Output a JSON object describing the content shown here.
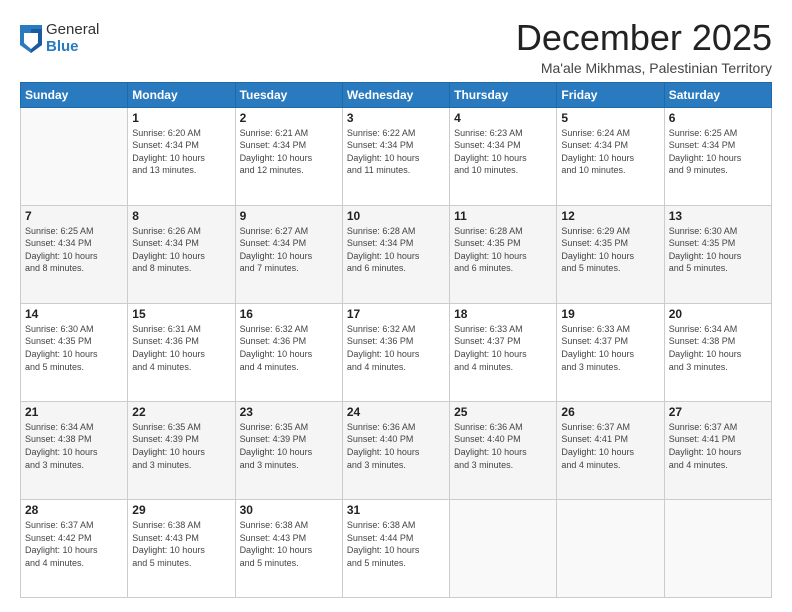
{
  "logo": {
    "general": "General",
    "blue": "Blue"
  },
  "title": "December 2025",
  "subtitle": "Ma'ale Mikhmas, Palestinian Territory",
  "weekdays": [
    "Sunday",
    "Monday",
    "Tuesday",
    "Wednesday",
    "Thursday",
    "Friday",
    "Saturday"
  ],
  "weeks": [
    [
      {
        "day": "",
        "info": ""
      },
      {
        "day": "1",
        "info": "Sunrise: 6:20 AM\nSunset: 4:34 PM\nDaylight: 10 hours\nand 13 minutes."
      },
      {
        "day": "2",
        "info": "Sunrise: 6:21 AM\nSunset: 4:34 PM\nDaylight: 10 hours\nand 12 minutes."
      },
      {
        "day": "3",
        "info": "Sunrise: 6:22 AM\nSunset: 4:34 PM\nDaylight: 10 hours\nand 11 minutes."
      },
      {
        "day": "4",
        "info": "Sunrise: 6:23 AM\nSunset: 4:34 PM\nDaylight: 10 hours\nand 10 minutes."
      },
      {
        "day": "5",
        "info": "Sunrise: 6:24 AM\nSunset: 4:34 PM\nDaylight: 10 hours\nand 10 minutes."
      },
      {
        "day": "6",
        "info": "Sunrise: 6:25 AM\nSunset: 4:34 PM\nDaylight: 10 hours\nand 9 minutes."
      }
    ],
    [
      {
        "day": "7",
        "info": "Sunrise: 6:25 AM\nSunset: 4:34 PM\nDaylight: 10 hours\nand 8 minutes."
      },
      {
        "day": "8",
        "info": "Sunrise: 6:26 AM\nSunset: 4:34 PM\nDaylight: 10 hours\nand 8 minutes."
      },
      {
        "day": "9",
        "info": "Sunrise: 6:27 AM\nSunset: 4:34 PM\nDaylight: 10 hours\nand 7 minutes."
      },
      {
        "day": "10",
        "info": "Sunrise: 6:28 AM\nSunset: 4:34 PM\nDaylight: 10 hours\nand 6 minutes."
      },
      {
        "day": "11",
        "info": "Sunrise: 6:28 AM\nSunset: 4:35 PM\nDaylight: 10 hours\nand 6 minutes."
      },
      {
        "day": "12",
        "info": "Sunrise: 6:29 AM\nSunset: 4:35 PM\nDaylight: 10 hours\nand 5 minutes."
      },
      {
        "day": "13",
        "info": "Sunrise: 6:30 AM\nSunset: 4:35 PM\nDaylight: 10 hours\nand 5 minutes."
      }
    ],
    [
      {
        "day": "14",
        "info": "Sunrise: 6:30 AM\nSunset: 4:35 PM\nDaylight: 10 hours\nand 5 minutes."
      },
      {
        "day": "15",
        "info": "Sunrise: 6:31 AM\nSunset: 4:36 PM\nDaylight: 10 hours\nand 4 minutes."
      },
      {
        "day": "16",
        "info": "Sunrise: 6:32 AM\nSunset: 4:36 PM\nDaylight: 10 hours\nand 4 minutes."
      },
      {
        "day": "17",
        "info": "Sunrise: 6:32 AM\nSunset: 4:36 PM\nDaylight: 10 hours\nand 4 minutes."
      },
      {
        "day": "18",
        "info": "Sunrise: 6:33 AM\nSunset: 4:37 PM\nDaylight: 10 hours\nand 4 minutes."
      },
      {
        "day": "19",
        "info": "Sunrise: 6:33 AM\nSunset: 4:37 PM\nDaylight: 10 hours\nand 3 minutes."
      },
      {
        "day": "20",
        "info": "Sunrise: 6:34 AM\nSunset: 4:38 PM\nDaylight: 10 hours\nand 3 minutes."
      }
    ],
    [
      {
        "day": "21",
        "info": "Sunrise: 6:34 AM\nSunset: 4:38 PM\nDaylight: 10 hours\nand 3 minutes."
      },
      {
        "day": "22",
        "info": "Sunrise: 6:35 AM\nSunset: 4:39 PM\nDaylight: 10 hours\nand 3 minutes."
      },
      {
        "day": "23",
        "info": "Sunrise: 6:35 AM\nSunset: 4:39 PM\nDaylight: 10 hours\nand 3 minutes."
      },
      {
        "day": "24",
        "info": "Sunrise: 6:36 AM\nSunset: 4:40 PM\nDaylight: 10 hours\nand 3 minutes."
      },
      {
        "day": "25",
        "info": "Sunrise: 6:36 AM\nSunset: 4:40 PM\nDaylight: 10 hours\nand 3 minutes."
      },
      {
        "day": "26",
        "info": "Sunrise: 6:37 AM\nSunset: 4:41 PM\nDaylight: 10 hours\nand 4 minutes."
      },
      {
        "day": "27",
        "info": "Sunrise: 6:37 AM\nSunset: 4:41 PM\nDaylight: 10 hours\nand 4 minutes."
      }
    ],
    [
      {
        "day": "28",
        "info": "Sunrise: 6:37 AM\nSunset: 4:42 PM\nDaylight: 10 hours\nand 4 minutes."
      },
      {
        "day": "29",
        "info": "Sunrise: 6:38 AM\nSunset: 4:43 PM\nDaylight: 10 hours\nand 5 minutes."
      },
      {
        "day": "30",
        "info": "Sunrise: 6:38 AM\nSunset: 4:43 PM\nDaylight: 10 hours\nand 5 minutes."
      },
      {
        "day": "31",
        "info": "Sunrise: 6:38 AM\nSunset: 4:44 PM\nDaylight: 10 hours\nand 5 minutes."
      },
      {
        "day": "",
        "info": ""
      },
      {
        "day": "",
        "info": ""
      },
      {
        "day": "",
        "info": ""
      }
    ]
  ]
}
